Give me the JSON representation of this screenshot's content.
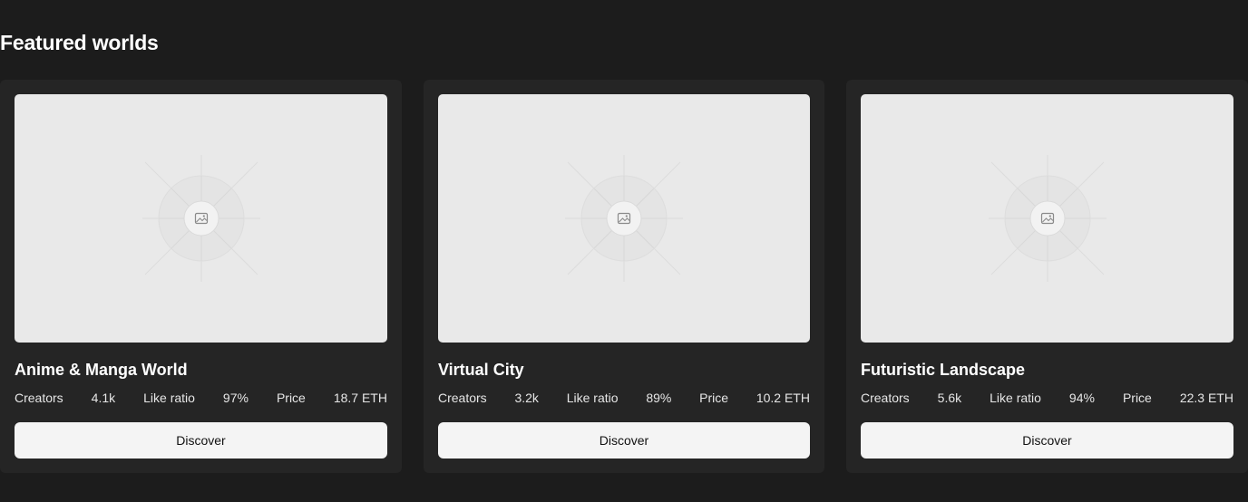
{
  "section": {
    "title": "Featured worlds"
  },
  "cards": [
    {
      "title": "Anime & Manga World",
      "creators_label": "Creators",
      "creators_value": "4.1k",
      "like_ratio_label": "Like ratio",
      "like_ratio_value": "97%",
      "price_label": "Price",
      "price_value": "18.7 ETH",
      "button_label": "Discover",
      "image_icon": "image-placeholder-icon"
    },
    {
      "title": "Virtual City",
      "creators_label": "Creators",
      "creators_value": "3.2k",
      "like_ratio_label": "Like ratio",
      "like_ratio_value": "89%",
      "price_label": "Price",
      "price_value": "10.2 ETH",
      "button_label": "Discover",
      "image_icon": "image-placeholder-icon"
    },
    {
      "title": "Futuristic Landscape",
      "creators_label": "Creators",
      "creators_value": "5.6k",
      "like_ratio_label": "Like ratio",
      "like_ratio_value": "94%",
      "price_label": "Price",
      "price_value": "22.3 ETH",
      "button_label": "Discover",
      "image_icon": "image-placeholder-icon"
    }
  ],
  "colors": {
    "background": "#1c1c1c",
    "card": "#252525",
    "thumbnail": "#e9e9e9",
    "button": "#f4f4f4",
    "text": "#ffffff"
  }
}
